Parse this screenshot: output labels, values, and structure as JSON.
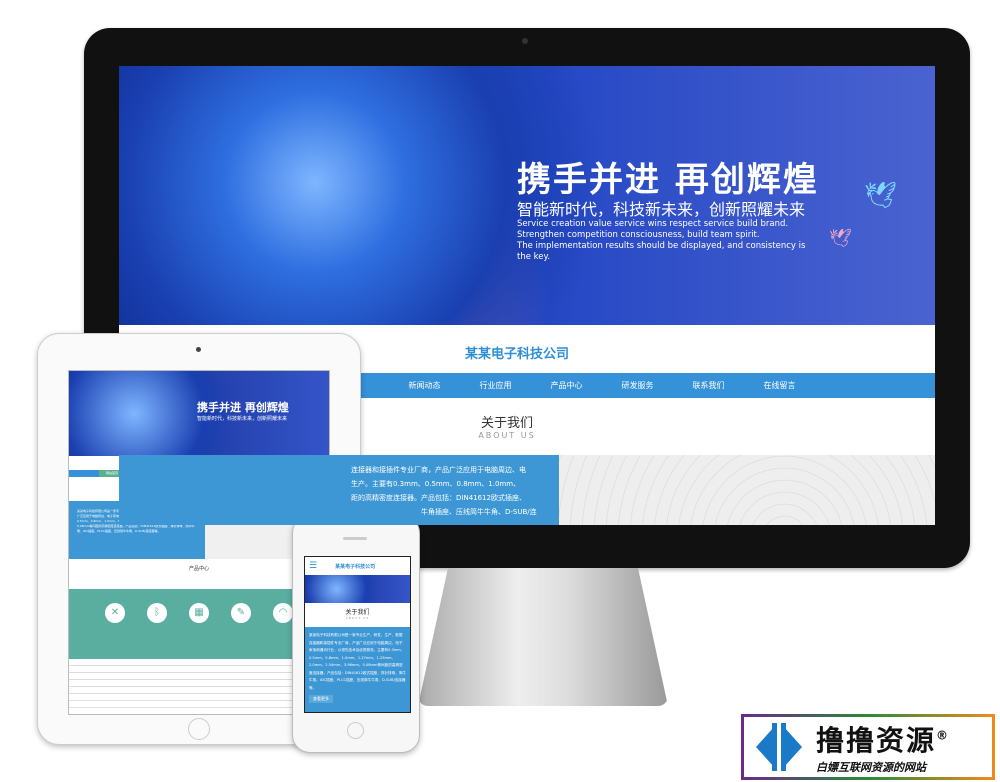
{
  "monitor": {
    "banner": {
      "title": "携手并进  再创辉煌",
      "subtitle": "智能新时代，科技新未来，创新照耀未来",
      "english": [
        "Service creation value service wins respect service build brand.",
        "Strengthen competition consciousness, build team spirit.",
        "The implementation results should be displayed, and consistency is the key."
      ]
    },
    "logo": "某某电子科技公司",
    "nav": [
      "新闻动态",
      "行业应用",
      "产品中心",
      "研发服务",
      "联系我们",
      "在线留言"
    ],
    "about": {
      "title": "关于我们",
      "subtitle": "ABOUT US",
      "lines": [
        "连接器和接插件专业厂商，产品广泛应用于电脑周边、电",
        "生产。主要有0.3mm、0.5mm、0.8mm、1.0mm、",
        "距的高精密度连接器。产品包括：DIN41612欧式插座、",
        "牛角插座、压线简牛牛角、D-SUB/连"
      ]
    }
  },
  "ipad": {
    "banner_title": "携手并进  再创辉煌",
    "banner_subtitle": "智能新时代，科技新未来，创新照耀未来",
    "logo": "某某电子科技公司",
    "nav": [
      "网站首页",
      "关于我们",
      "新闻动态",
      "行业应用",
      "产品中心",
      "研发服务",
      "联系我们",
      "在线留言"
    ],
    "about_title": "关于我们",
    "products_title": "产品中心",
    "product_icons": [
      "tools-icon",
      "bluetooth-icon",
      "chip-icon",
      "wrench-icon",
      "wifi-icon"
    ]
  },
  "phone": {
    "menu_icon": "☰",
    "logo": "某某电子科技公司",
    "about_title": "关于我们",
    "about_subtitle": "ABOUT US",
    "about_text": "某某电子科技有限公司是一家专业生产、研发、生产、数据连接器和接插件专业厂商，产品广泛应用于电脑周边、电子家电和通讯行业，以领先技术及优质服务。主要有0.3mm、0.5mm、0.8mm、1.0mm、1.27mm、1.25mm、2.0mm、2.54mm、3.96mm、5.08mm等间距的高精密度连接器。产品包括：DIN41612欧式插座、排针排母、简牛牛角、IDC插座、PLCC插座、压线简牛牛角、D-SUB/连接器等。",
    "more_button": "查看更多"
  },
  "watermark": {
    "name": "撸撸资源",
    "registered": "®",
    "tagline": "白嫖互联网资源的网站"
  }
}
